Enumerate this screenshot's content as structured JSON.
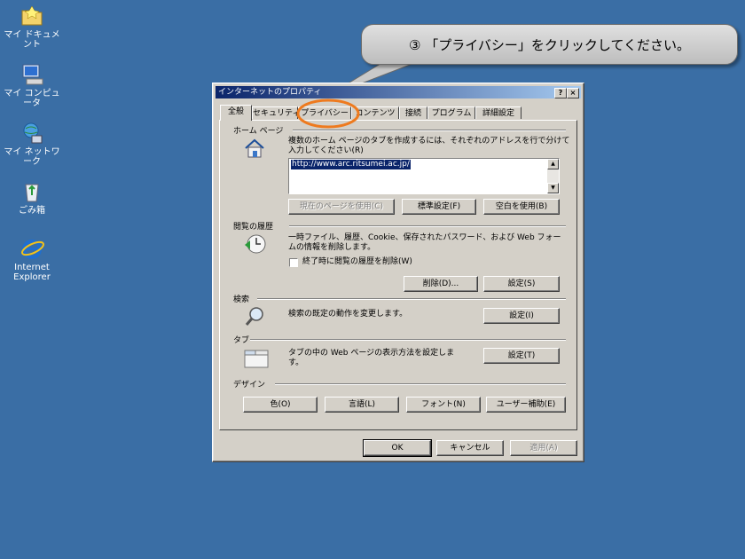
{
  "desktop": {
    "icons": [
      {
        "label": "マイ ドキュメント",
        "icon": "my-documents-icon"
      },
      {
        "label": "マイ コンピュータ",
        "icon": "my-computer-icon"
      },
      {
        "label": "マイ ネットワーク",
        "icon": "my-network-icon"
      },
      {
        "label": "ごみ箱",
        "icon": "recycle-bin-icon"
      },
      {
        "label": "Internet\nExplorer",
        "icon": "internet-explorer-icon"
      }
    ]
  },
  "callout": {
    "text": "③ 「プライバシー」をクリックしてください。"
  },
  "dialog": {
    "title": "インターネットのプロパティ",
    "help_button": "?",
    "close_button": "×",
    "tabs": [
      "全般",
      "セキュリティ",
      "プライバシー",
      "コンテンツ",
      "接続",
      "プログラム",
      "詳細設定"
    ],
    "home": {
      "heading": "ホーム ページ",
      "description": "複数のホーム ページのタブを作成するには、それぞれのアドレスを行で分けて入力してください(R)",
      "url": "http://www.arc.ritsumei.ac.jp/",
      "btn_current": "現在のページを使用(C)",
      "btn_default": "標準設定(F)",
      "btn_blank": "空白を使用(B)"
    },
    "history": {
      "heading": "閲覧の履歴",
      "description": "一時ファイル、履歴、Cookie、保存されたパスワード、および Web フォームの情報を削除します。",
      "checkbox_label": "終了時に閲覧の履歴を削除(W)",
      "btn_delete": "削除(D)...",
      "btn_settings": "設定(S)"
    },
    "search": {
      "heading": "検索",
      "description": "検索の既定の動作を変更します。",
      "btn_settings": "設定(I)"
    },
    "tabsect": {
      "heading": "タブ",
      "description": "タブの中の Web ページの表示方法を設定します。",
      "btn_settings": "設定(T)"
    },
    "design": {
      "heading": "デザイン",
      "btn_colors": "色(O)",
      "btn_languages": "言語(L)",
      "btn_fonts": "フォント(N)",
      "btn_accessibility": "ユーザー補助(E)"
    },
    "footer": {
      "ok": "OK",
      "cancel": "キャンセル",
      "apply": "適用(A)"
    }
  }
}
